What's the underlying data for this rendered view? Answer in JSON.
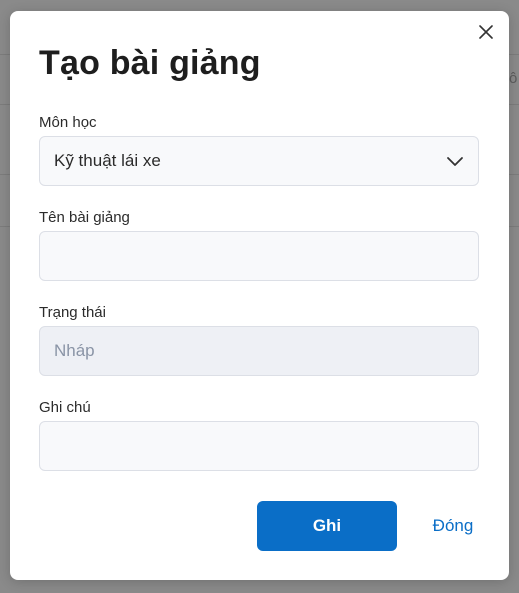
{
  "background": {
    "partial_text": "ô"
  },
  "dialog": {
    "title": "Tạo bài giảng",
    "close_icon": "close-icon",
    "fields": {
      "subject": {
        "label": "Môn học",
        "value": "Kỹ thuật lái xe",
        "icon": "chevron-down-icon"
      },
      "lesson_name": {
        "label": "Tên bài giảng",
        "value": "",
        "placeholder": ""
      },
      "status": {
        "label": "Trạng thái",
        "value": "Nháp"
      },
      "note": {
        "label": "Ghi chú",
        "value": "",
        "placeholder": ""
      }
    },
    "buttons": {
      "save": "Ghi",
      "close": "Đóng"
    }
  },
  "colors": {
    "primary": "#0a6ec7",
    "overlay": "#8a8a8a",
    "field_bg": "#f8f9fb",
    "disabled_bg": "#eef0f5"
  }
}
